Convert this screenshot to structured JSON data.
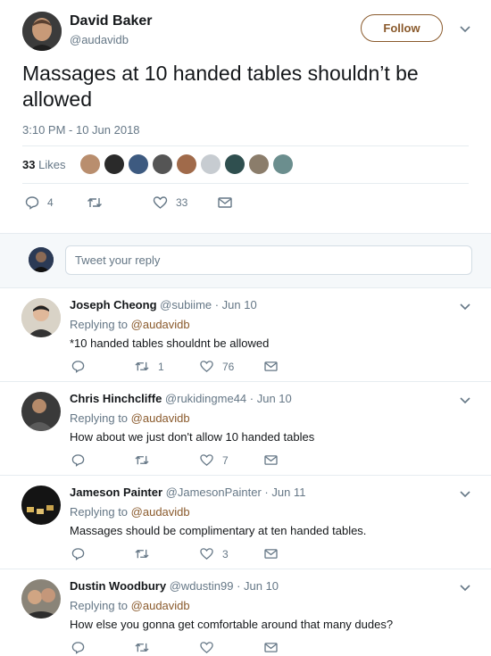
{
  "tweet": {
    "author_name": "David Baker",
    "author_handle": "@audavidb",
    "follow_label": "Follow",
    "text": "Massages at 10 handed tables shouldn’t be allowed",
    "timestamp": "3:10 PM - 10 Jun 2018",
    "likes_count": "33",
    "likes_label": "Likes",
    "actions": {
      "replies": "4",
      "retweets": "",
      "likes": "33"
    }
  },
  "reply_box": {
    "placeholder": "Tweet your reply"
  },
  "replies": [
    {
      "name": "Joseph Cheong",
      "meta": "@subiime · Jun 10",
      "replying_prefix": "Replying to",
      "replying_to": "@audavidb",
      "text": "*10 handed tables shouldnt be allowed",
      "retweets": "1",
      "likes": "76"
    },
    {
      "name": "Chris Hinchcliffe",
      "meta": "@rukidingme44 · Jun 10",
      "replying_prefix": "Replying to",
      "replying_to": "@audavidb",
      "text": "How about we just don't allow 10 handed tables",
      "retweets": "",
      "likes": "7"
    },
    {
      "name": "Jameson Painter",
      "meta": "@JamesonPainter · Jun 11",
      "replying_prefix": "Replying to",
      "replying_to": "@audavidb",
      "text": "Massages should be complimentary at ten handed tables.",
      "retweets": "",
      "likes": "3"
    },
    {
      "name": "Dustin Woodbury",
      "meta": "@wdustin99 · Jun 10",
      "replying_prefix": "Replying to",
      "replying_to": "@audavidb",
      "text": "How else you gonna get comfortable around that many dudes?",
      "retweets": "",
      "likes": ""
    }
  ],
  "colors": {
    "accent": "#8a5a2c",
    "muted": "#657786",
    "divider": "#e6ecf0",
    "reply_bg": "#f5f8fa"
  }
}
